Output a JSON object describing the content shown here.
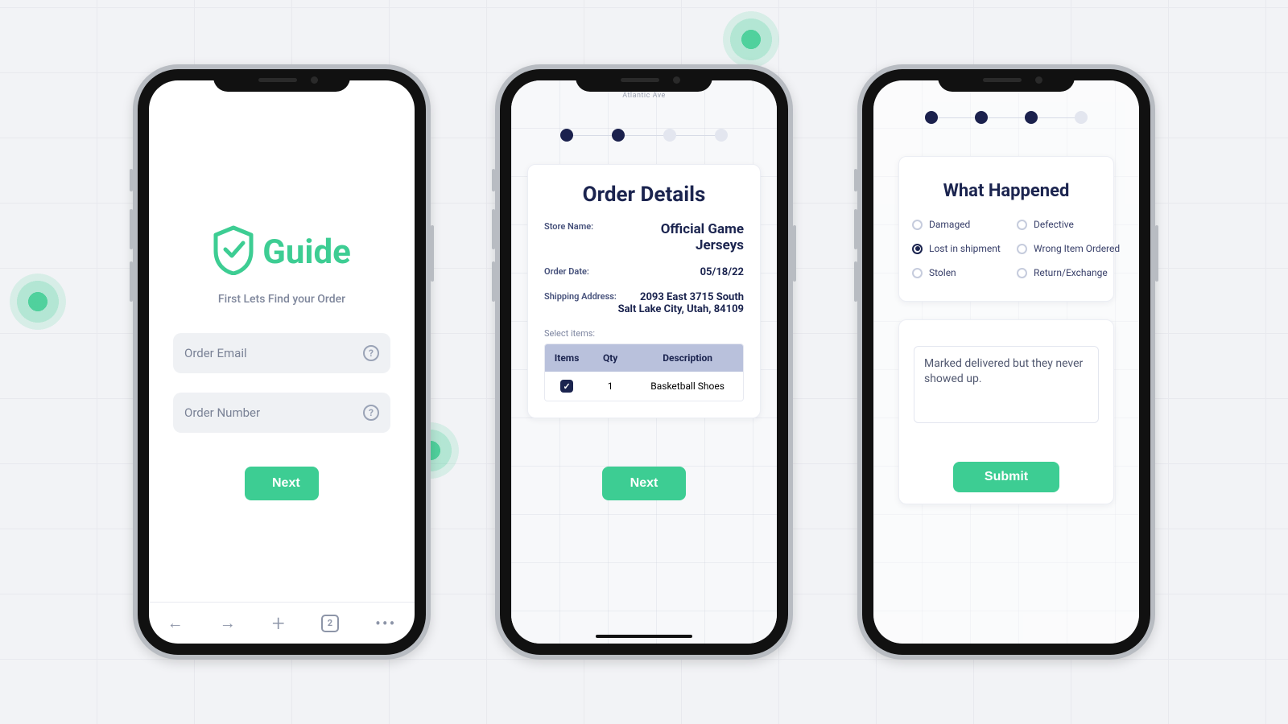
{
  "brand": {
    "name": "Guide"
  },
  "decor": {
    "map_street_label": "Atlantic Ave"
  },
  "screen1": {
    "subtitle": "First Lets Find your Order",
    "email_placeholder": "Order Email",
    "number_placeholder": "Order Number",
    "next_label": "Next",
    "tabs_count": "2",
    "stepper": [
      true,
      false,
      false,
      false
    ]
  },
  "screen2": {
    "stepper": [
      true,
      true,
      false,
      false
    ],
    "title": "Order Details",
    "store_label": "Store Name:",
    "store_value": "Official Game Jerseys",
    "date_label": "Order Date:",
    "date_value": "05/18/22",
    "ship_label": "Shipping Address:",
    "ship_line1": "2093 East 3715 South",
    "ship_line2": "Salt Lake City, Utah, 84109",
    "select_items_label": "Select items:",
    "columns": {
      "items": "Items",
      "qty": "Qty",
      "desc": "Description"
    },
    "row": {
      "checked": true,
      "qty": "1",
      "desc": "Basketball Shoes"
    },
    "next_label": "Next"
  },
  "screen3": {
    "stepper": [
      true,
      true,
      true,
      false
    ],
    "title": "What Happened",
    "options": [
      {
        "label": "Damaged",
        "selected": false
      },
      {
        "label": "Defective",
        "selected": false
      },
      {
        "label": "Lost in shipment",
        "selected": true
      },
      {
        "label": "Wrong Item Ordered",
        "selected": false
      },
      {
        "label": "Stolen",
        "selected": false
      },
      {
        "label": "Return/Exchange",
        "selected": false
      }
    ],
    "note": "Marked delivered but they never showed up.",
    "submit_label": "Submit"
  }
}
